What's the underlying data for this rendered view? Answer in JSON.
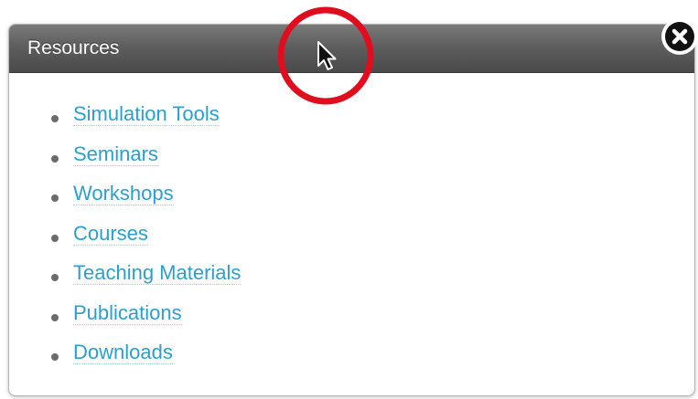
{
  "panel": {
    "title": "Resources"
  },
  "resources": [
    {
      "label": "Simulation Tools"
    },
    {
      "label": "Seminars"
    },
    {
      "label": "Workshops"
    },
    {
      "label": "Courses"
    },
    {
      "label": "Teaching Materials"
    },
    {
      "label": "Publications"
    },
    {
      "label": "Downloads"
    }
  ],
  "icons": {
    "close": "close-icon",
    "cursor": "mouse-pointer-icon",
    "annotation": "red-circle-annotation"
  },
  "colors": {
    "header": "#5e5e5e",
    "link": "#2a9fd0",
    "annotation": "#e00d1f"
  }
}
